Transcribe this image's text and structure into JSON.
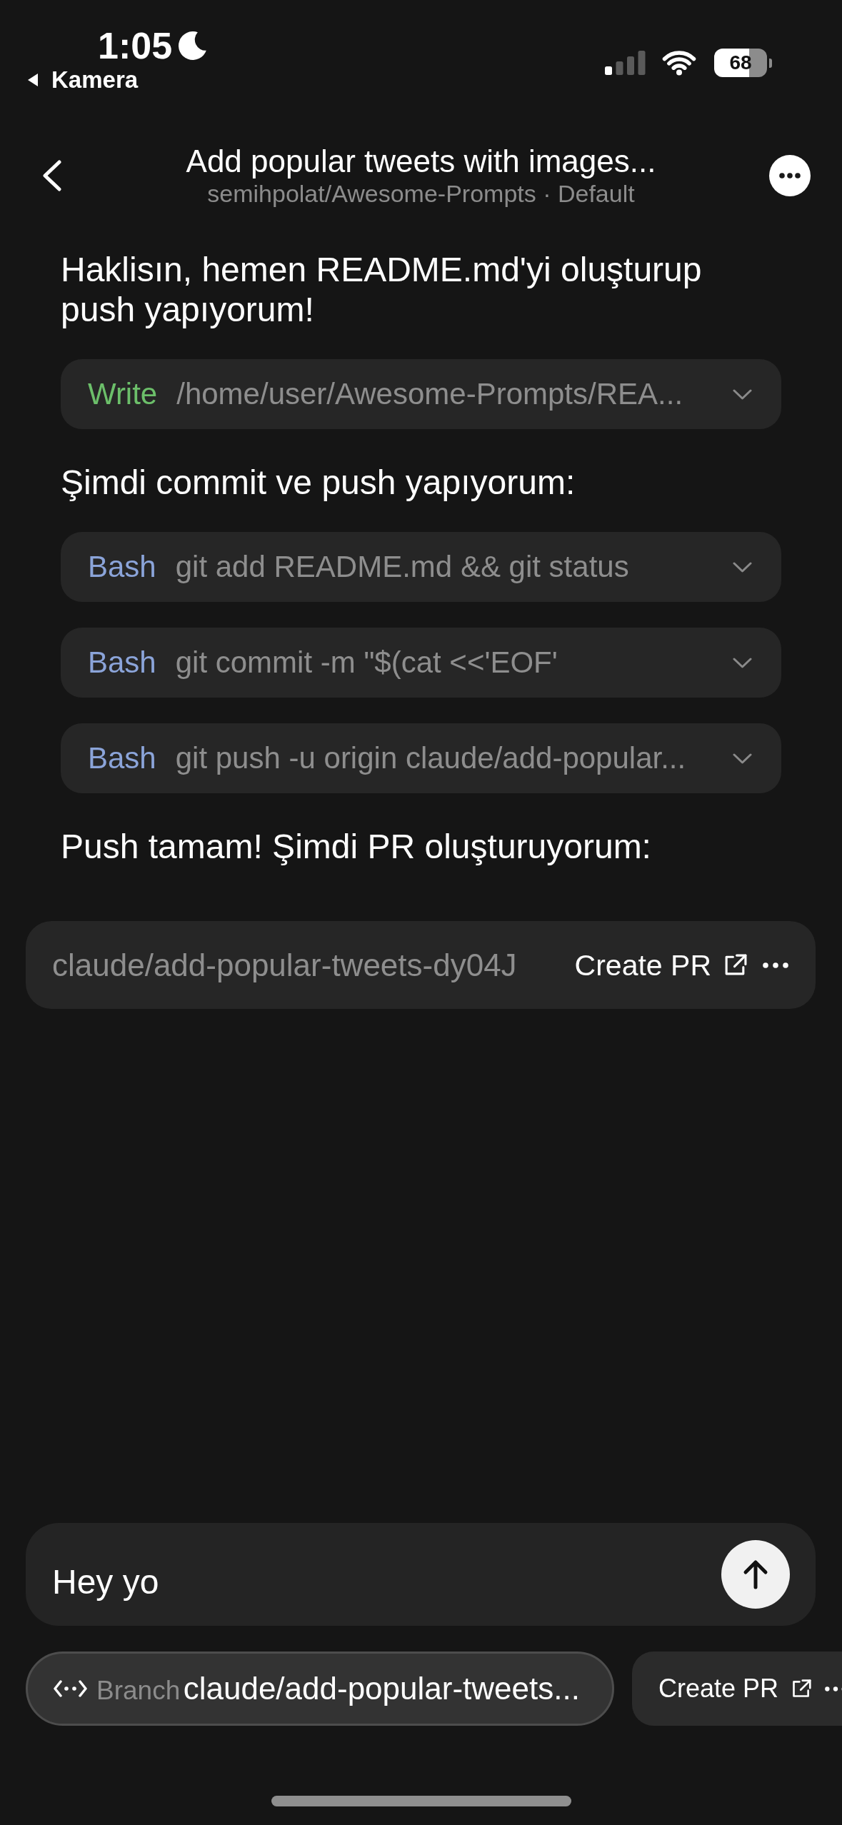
{
  "status_bar": {
    "time": "1:05",
    "back_link": "Kamera",
    "battery": "68"
  },
  "header": {
    "title": "Add popular tweets with images...",
    "subtitle": "semihpolat/Awesome-Prompts · Default"
  },
  "messages": [
    {
      "kind": "text",
      "text": "Haklisın, hemen README.md'yi oluşturup push yapıyorum!"
    },
    {
      "kind": "tool",
      "tool": "Write",
      "color": "#6cbf6a",
      "command": "/home/user/Awesome-Prompts/REA...",
      "expanded": false
    },
    {
      "kind": "text",
      "text": "Şimdi commit ve push yapıyorum:"
    },
    {
      "kind": "tool",
      "tool": "Bash",
      "color": "#8ba4d9",
      "command": "git add README.md && git status",
      "expanded": false
    },
    {
      "kind": "tool",
      "tool": "Bash",
      "color": "#8ba4d9",
      "command": "git commit -m \"$(cat <<'EOF'",
      "expanded": false
    },
    {
      "kind": "tool",
      "tool": "Bash",
      "color": "#8ba4d9",
      "command": "git push -u origin claude/add-popular...",
      "expanded": false
    },
    {
      "kind": "text",
      "text": "Push tamam! Şimdi PR oluşturuyorum:"
    }
  ],
  "pr_bar": {
    "branch": "claude/add-popular-tweets-dy04J",
    "action": "Create PR"
  },
  "composer": {
    "value": "Hey yo"
  },
  "chips": [
    {
      "kind": "branch",
      "label": "Branch",
      "value": "claude/add-popular-tweets..."
    },
    {
      "kind": "pr",
      "action": "Create PR"
    }
  ]
}
